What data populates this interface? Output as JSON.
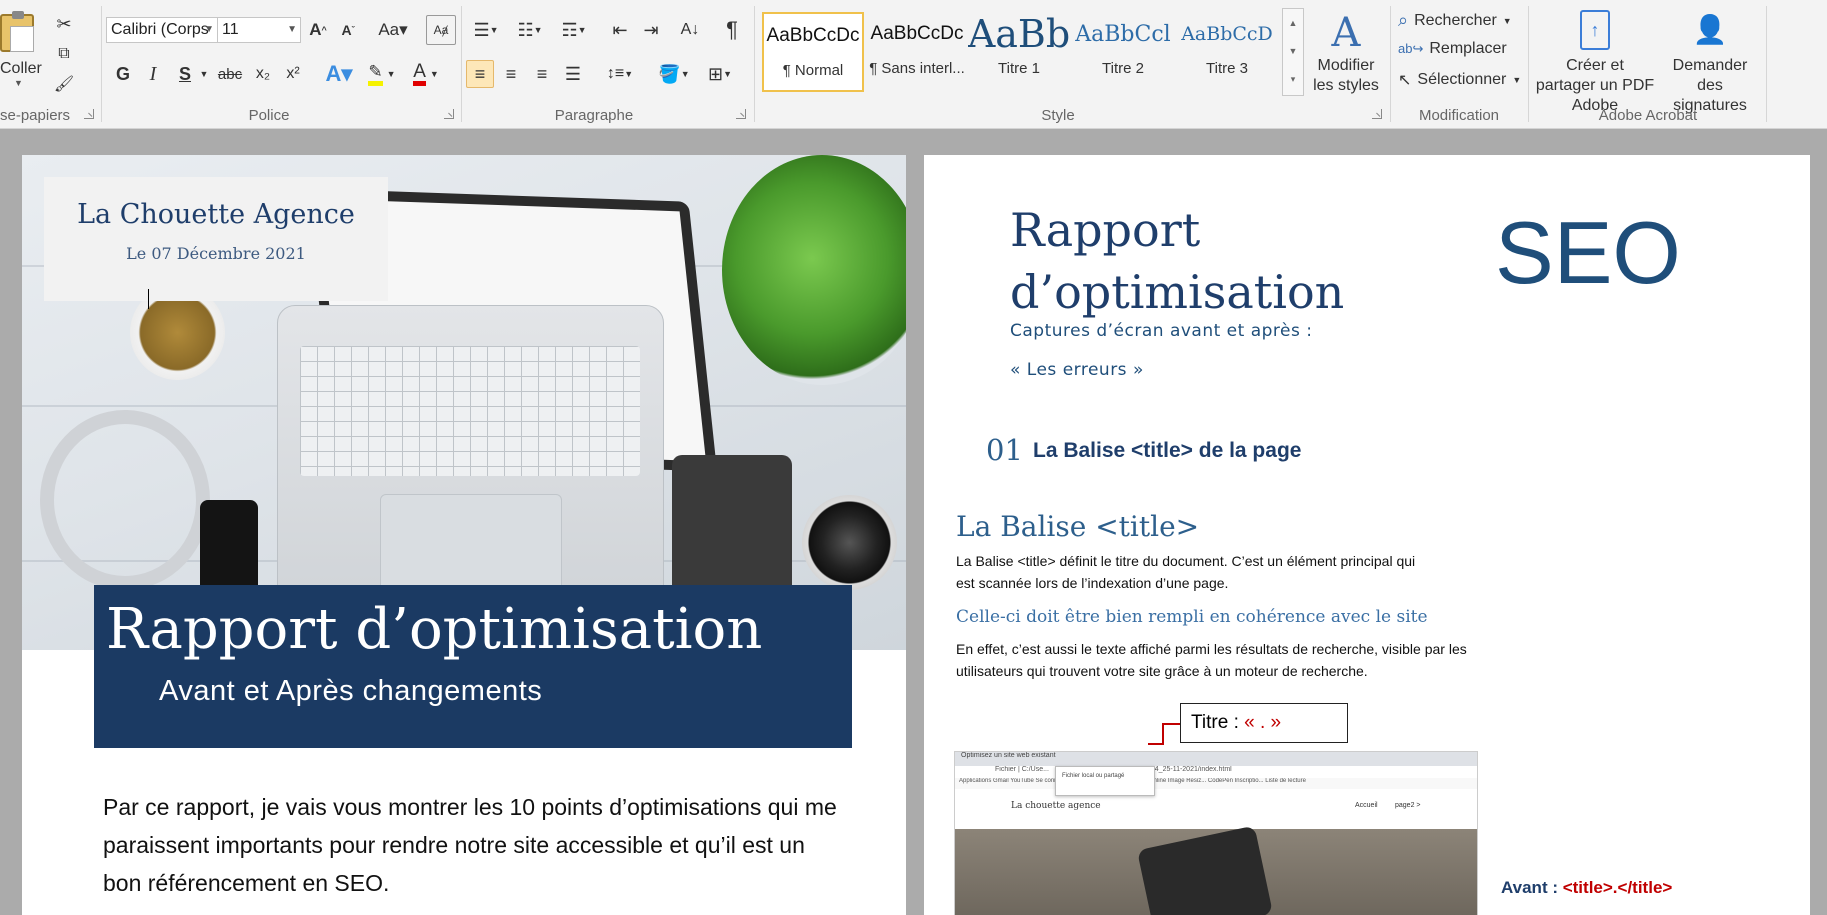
{
  "ribbon": {
    "clipboard": {
      "paste_label": "Coller",
      "group_label": "se-papiers"
    },
    "font": {
      "font_name": "Calibri (Corps",
      "font_size": "11",
      "bold": "G",
      "italic": "I",
      "underline": "S",
      "strike": "abc",
      "group_label": "Police"
    },
    "paragraph": {
      "group_label": "Paragraphe",
      "pilcrow": "¶"
    },
    "styles": {
      "group_label": "Style",
      "tiles": [
        {
          "sample": "AaBbCcDc",
          "name": "¶ Normal"
        },
        {
          "sample": "AaBbCcDc",
          "name": "¶ Sans interl..."
        },
        {
          "sample": "AaBb",
          "name": "Titre 1"
        },
        {
          "sample": "AaBbCcl",
          "name": "Titre 2"
        },
        {
          "sample": "AaBbCcD",
          "name": "Titre 3"
        }
      ],
      "modify_label": "Modifier les styles"
    },
    "editing": {
      "group_label": "Modification",
      "find": "Rechercher",
      "replace": "Remplacer",
      "select": "Sélectionner"
    },
    "acrobat": {
      "group_label": "Adobe Acrobat",
      "create_pdf": "Créer et partager un PDF Adobe",
      "request_sign": "Demander des signatures"
    }
  },
  "cover": {
    "agency": "La Chouette Agence",
    "date": "Le 07 Décembre 2021",
    "title": "Rapport d’optimisation",
    "subtitle": "Avant et Après changements",
    "intro": "Par ce rapport, je vais vous montrer les 10 points d’optimisations qui me paraissent importants pour rendre notre site accessible et qu’il est un bon référencement  en SEO."
  },
  "report": {
    "heading_line1": "Rapport",
    "heading_line2": "d’optimisation",
    "seo": "SEO",
    "caption1": "Captures d’écran avant et après :",
    "caption2": "« Les erreurs »",
    "section_num": "01",
    "section_title": "La Balise <title> de la page",
    "h2": "La Balise <title>",
    "para1_line1": "La Balise <title> définit le titre du document.  C’est un élément principal qui",
    "para1_line2": "est scannée lors de l’indexation d’une page.",
    "h3": "Celle-ci doit être bien rempli en cohérence avec le site",
    "para2_line1": "En effet, c’est aussi le texte affiché parmi les résultats de recherche, visible par les",
    "para2_line2": "utilisateurs qui trouvent votre site grâce à  un moteur de recherche.",
    "callout_label": "Titre : ",
    "callout_value": "« . »",
    "avant_label": "Avant : ",
    "avant_value": "<title>.</title>"
  },
  "screenshot": {
    "tab1": "Optimisez un site web existant",
    "address": "Fichier | C:/Use...",
    "address2": "...4_25-11-2021/index.html",
    "bookmarks": "Applications   Gmail   YouTube   Se connecter - Com...   Des parcours dipl...   Online Image Resiz...   CodePen Inscriptio...   Liste de lecture",
    "popup": "Fichier local ou partagé",
    "brand": "La chouette agence",
    "nav1": "Accueil",
    "nav2": "page2 >"
  },
  "colors": {
    "accent_dark_blue": "#1b3a63",
    "heading_blue": "#1f3e6b",
    "red": "#c00000"
  }
}
